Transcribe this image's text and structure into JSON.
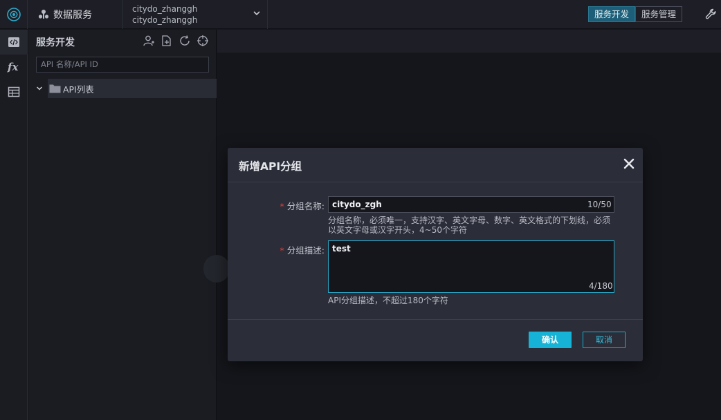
{
  "topbar": {
    "product_name": "数据服务",
    "workspace_line1": "citydo_zhanggh",
    "workspace_line2": "citydo_zhanggh",
    "modes": [
      "服务开发",
      "服务管理"
    ],
    "active_mode": "服务开发"
  },
  "leftnav": {
    "items": [
      {
        "icon": "code-icon",
        "label": "</>"
      },
      {
        "icon": "function-icon",
        "label": "fx"
      },
      {
        "icon": "table-icon",
        "label": ""
      }
    ]
  },
  "panel": {
    "title": "服务开发",
    "search_placeholder": "API 名称/API ID",
    "tree": [
      {
        "label": "API列表"
      }
    ]
  },
  "modal": {
    "title": "新增API分组",
    "name_label": "分组名称",
    "name_value": "citydo_zgh",
    "name_counter": "10/50",
    "name_hint_line1": "分组名称，必须唯一，支持汉字、英文字母、数字、英文格式的下划线，必须",
    "name_hint_line2": "以英文字母或汉字开头，4~50个字符",
    "desc_label": "分组描述",
    "desc_value": "test",
    "desc_counter": "4/180",
    "desc_hint": "API分组描述，不超过180个字符",
    "confirm_label": "确认",
    "cancel_label": "取消",
    "required_mark": "*",
    "colon": ":"
  },
  "colors": {
    "accent": "#17b3d6",
    "required": "#e0413c",
    "background": "#15161b",
    "modal": "#2b2d38"
  }
}
